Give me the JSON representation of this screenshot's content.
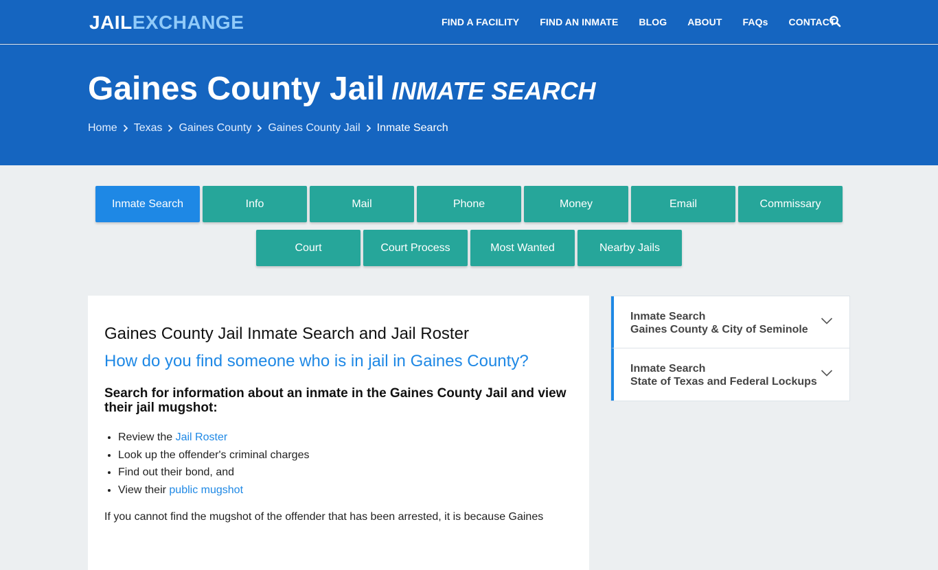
{
  "header": {
    "logo_part1": "JAIL",
    "logo_part2": "EXCHANGE",
    "nav": [
      "FIND A FACILITY",
      "FIND AN INMATE",
      "BLOG",
      "ABOUT",
      "FAQs",
      "CONTACT"
    ],
    "search_icon": "search-icon"
  },
  "hero": {
    "title": "Gaines County Jail",
    "subtitle": "INMATE SEARCH",
    "breadcrumbs": [
      "Home",
      "Texas",
      "Gaines County",
      "Gaines County Jail",
      "Inmate Search"
    ]
  },
  "tabs": {
    "row1": [
      "Inmate Search",
      "Info",
      "Mail",
      "Phone",
      "Money",
      "Email",
      "Commissary"
    ],
    "row2": [
      "Court",
      "Court Process",
      "Most Wanted",
      "Nearby Jails"
    ],
    "active": "Inmate Search"
  },
  "main": {
    "heading": "Gaines County Jail Inmate Search and Jail Roster",
    "question": "How do you find someone who is in jail in Gaines County?",
    "intro": "Search for information about an inmate in the Gaines County Jail and view their jail mugshot:",
    "list": [
      {
        "text": "Review the ",
        "link": "Jail Roster"
      },
      {
        "text": "Look up the offender's criminal charges",
        "link": ""
      },
      {
        "text": "Find out their bond, and",
        "link": ""
      },
      {
        "text": "View their ",
        "link": "public mugshot"
      }
    ],
    "paragraph": "If you cannot find the mugshot of the offender that has been arrested, it is because Gaines"
  },
  "sidebar": {
    "items": [
      {
        "line1": "Inmate Search",
        "line2": "Gaines County & City of Seminole"
      },
      {
        "line1": "Inmate Search",
        "line2": "State of Texas and Federal Lockups"
      }
    ]
  },
  "colors": {
    "brand_blue": "#1565c0",
    "accent_blue": "#1e88e5",
    "teal": "#26a69a"
  }
}
